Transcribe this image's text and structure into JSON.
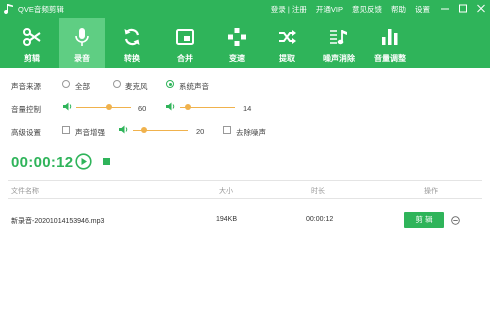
{
  "app": {
    "title": "QVE音频剪辑",
    "accent": "#2fb45a",
    "accent_active": "#5fce83"
  },
  "titlebar": {
    "menu": [
      "登录 | 注册",
      "开通VIP",
      "意见反馈",
      "帮助",
      "设置"
    ],
    "window_buttons": [
      "minimize-icon",
      "maximize-icon",
      "close-icon"
    ]
  },
  "toolbar": {
    "tools": [
      {
        "label": "剪辑",
        "icon": "scissors-icon"
      },
      {
        "label": "录音",
        "icon": "microphone-icon",
        "active": true
      },
      {
        "label": "转换",
        "icon": "refresh-icon"
      },
      {
        "label": "合并",
        "icon": "merge-icon"
      },
      {
        "label": "变速",
        "icon": "speed-icon"
      },
      {
        "label": "提取",
        "icon": "shuffle-icon"
      },
      {
        "label": "噪声消除",
        "icon": "music-note-icon"
      },
      {
        "label": "音量调整",
        "icon": "volume-bars-icon"
      }
    ]
  },
  "settings": {
    "source": {
      "label": "声音来源",
      "options": [
        "全部",
        "麦克风",
        "系统声音"
      ],
      "selected": "系统声音"
    },
    "volume": {
      "label": "音量控制",
      "mic_value": "60",
      "mic_level": 0.6,
      "sys_value": "14",
      "sys_level": 0.14
    },
    "advanced": {
      "label": "高级设置",
      "enhance_label": "声音增强",
      "enhance_checked": false,
      "enhance_value": "20",
      "enhance_level": 0.2,
      "denoise_label": "去除噪声",
      "denoise_checked": false
    }
  },
  "recorder": {
    "timer": "00:00:12",
    "play_icon": "play-icon",
    "stop_icon": "stop-icon"
  },
  "table": {
    "headers": {
      "name": "文件名称",
      "size": "大小",
      "duration": "时长",
      "action": "操作"
    },
    "rows": [
      {
        "name": "新录音-20201014153946.mp3",
        "size": "194KB",
        "duration": "00:00:12",
        "action": "剪 辑"
      }
    ]
  }
}
